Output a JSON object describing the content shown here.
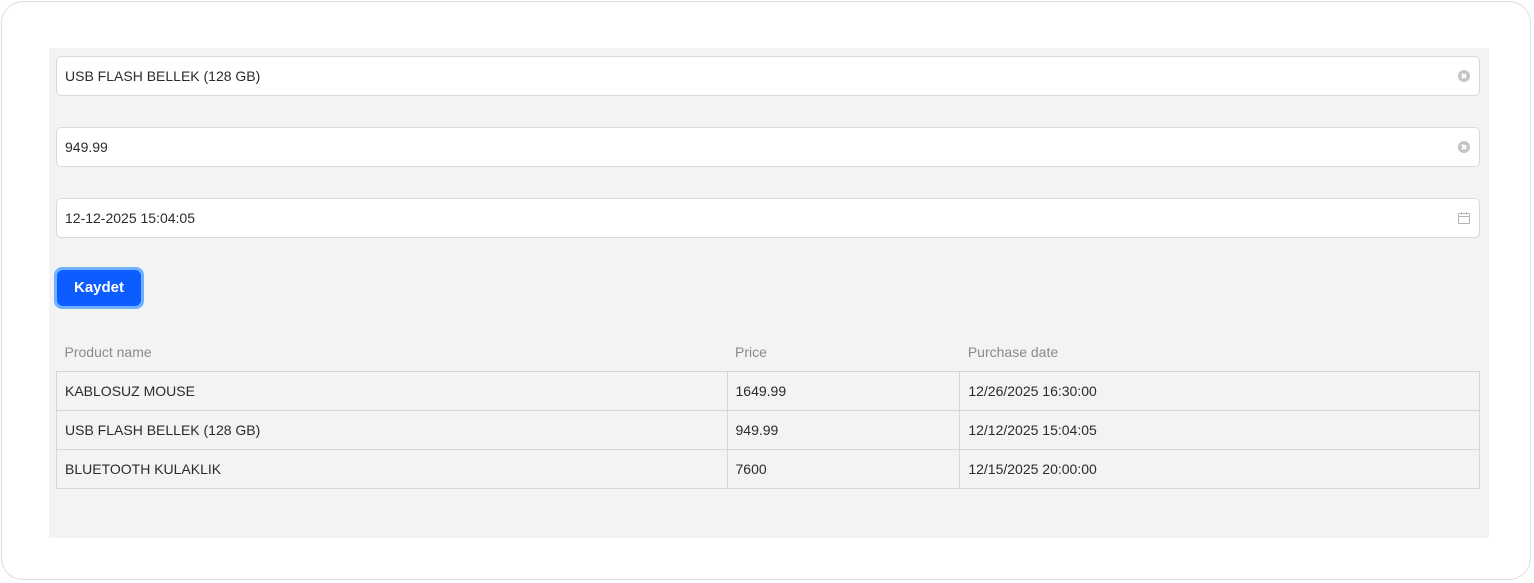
{
  "form": {
    "product_name_value": "USB FLASH BELLEK (128 GB)",
    "price_value": "949.99",
    "purchase_date_value": "12-12-2025 15:04:05",
    "save_label": "Kaydet"
  },
  "table": {
    "headers": [
      "Product name",
      "Price",
      "Purchase date"
    ],
    "rows": [
      [
        "KABLOSUZ MOUSE",
        "1649.99",
        "12/26/2025 16:30:00"
      ],
      [
        "USB FLASH BELLEK (128 GB)",
        "949.99",
        "12/12/2025 15:04:05"
      ],
      [
        "BLUETOOTH KULAKLIK",
        "7600",
        "12/15/2025 20:00:00"
      ]
    ]
  },
  "icons": {
    "clear": "clear-circle-x-icon",
    "calendar": "calendar-icon"
  },
  "colors": {
    "accent": "#0d5cff",
    "accent_focus_ring": "#6fb1ff",
    "panel_background": "#f3f3f3"
  }
}
